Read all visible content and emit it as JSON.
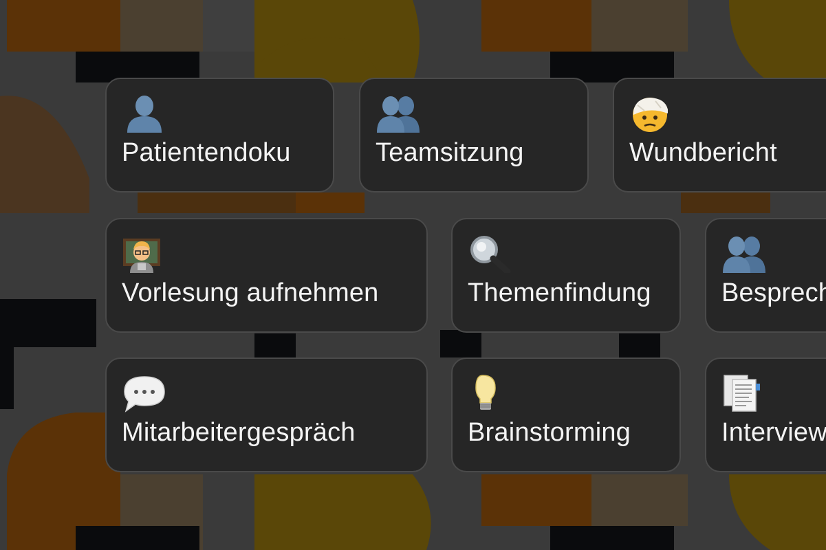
{
  "tiles": [
    {
      "label": "Patientendoku",
      "icon": "bust-in-silhouette-icon"
    },
    {
      "label": "Teamsitzung",
      "icon": "busts-in-silhouette-icon"
    },
    {
      "label": "Wundbericht",
      "icon": "face-with-head-bandage-icon"
    },
    {
      "label": "Vorlesung aufnehmen",
      "icon": "teacher-icon"
    },
    {
      "label": "Themenfindung",
      "icon": "magnifying-glass-icon"
    },
    {
      "label": "Besprech",
      "icon": "busts-in-silhouette-icon"
    },
    {
      "label": "Mitarbeitergespräch",
      "icon": "speech-bubble-icon"
    },
    {
      "label": "Brainstorming",
      "icon": "light-bulb-icon"
    },
    {
      "label": "Interview",
      "icon": "document-icon"
    }
  ],
  "colors": {
    "card_background": "#262626",
    "card_border": "#4a4a4a",
    "text": "#f4f4f4",
    "page_background": "#3a3a3a"
  }
}
